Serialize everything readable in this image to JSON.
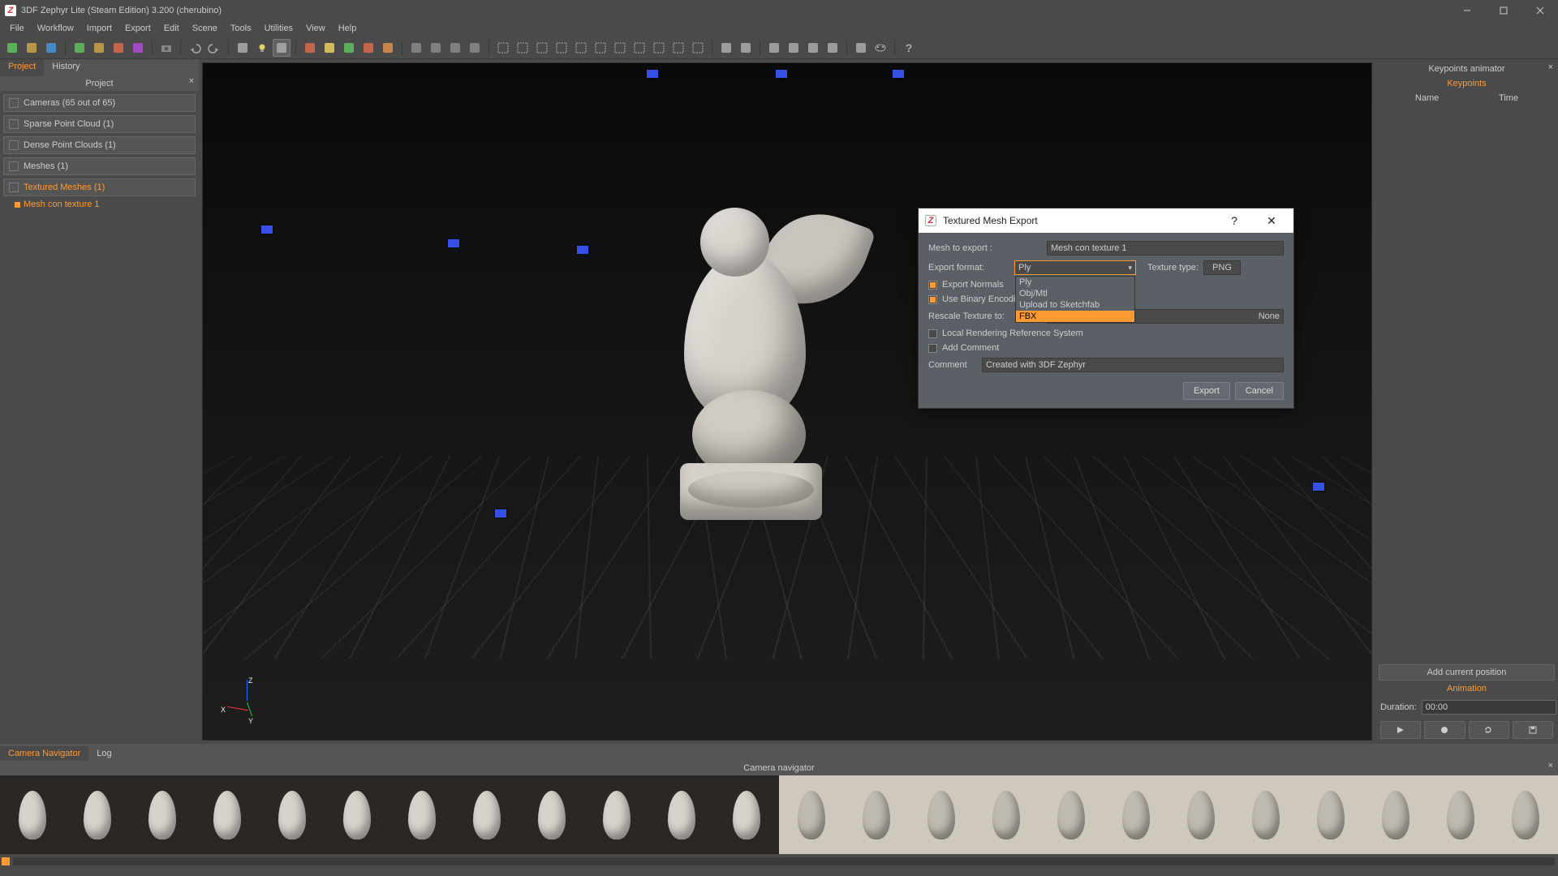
{
  "app": {
    "title": "3DF Zephyr Lite (Steam Edition) 3.200 (cherubino)"
  },
  "menu": [
    "File",
    "Workflow",
    "Import",
    "Export",
    "Edit",
    "Scene",
    "Tools",
    "Utilities",
    "View",
    "Help"
  ],
  "left": {
    "tabs": {
      "project": "Project",
      "history": "History"
    },
    "header": "Project",
    "items": [
      {
        "label": "Cameras (65 out of 65)"
      },
      {
        "label": "Sparse Point Cloud (1)"
      },
      {
        "label": "Dense Point Clouds (1)"
      },
      {
        "label": "Meshes (1)"
      },
      {
        "label": "Textured Meshes (1)",
        "selected": true
      }
    ],
    "subitem": "Mesh con texture 1"
  },
  "gizmo": {
    "x": "X",
    "y": "Y",
    "z": "Z"
  },
  "right": {
    "title": "Keypoints animator",
    "section1": "Keypoints",
    "col_name": "Name",
    "col_time": "Time",
    "add_btn": "Add current position",
    "section2": "Animation",
    "duration_label": "Duration:",
    "duration_value": "00:00"
  },
  "dialog": {
    "title": "Textured Mesh Export",
    "mesh_label": "Mesh to export :",
    "mesh_value": "Mesh con texture 1",
    "format_label": "Export format:",
    "format_value": "Ply",
    "texture_label": "Texture type:",
    "texture_value": "PNG",
    "list": {
      "ply": "Ply",
      "obj": "Obj/Mtl",
      "sketchfab": "Upload to Sketchfab",
      "fbx": "FBX"
    },
    "normals": "Export Normals",
    "binary": "Use Binary Encoding",
    "rescale_label": "Rescale Texture to:",
    "rescale_value": "None",
    "local_ref": "Local Rendering Reference System",
    "add_comment": "Add Comment",
    "comment_label": "Comment",
    "comment_value": "Created with 3DF Zephyr",
    "export_btn": "Export",
    "cancel_btn": "Cancel",
    "help": "?",
    "close": "✕"
  },
  "bottom": {
    "tabs": {
      "camnav": "Camera Navigator",
      "log": "Log"
    },
    "header": "Camera navigator"
  },
  "toolbar_icons": [
    "new",
    "open",
    "save",
    "sep",
    "wiz1",
    "wiz2",
    "wiz3",
    "wiz4",
    "sep",
    "camera",
    "sep",
    "undo",
    "redo",
    "sep",
    "hand",
    "light",
    "bbox",
    "sep",
    "shade1",
    "shade2",
    "shade3",
    "shade4",
    "shade5",
    "sep",
    "pts1",
    "pts2",
    "pts3",
    "pts4",
    "sep",
    "sel-rect",
    "sel-lasso",
    "sel-poly",
    "sel-color",
    "sel-plane",
    "sel-cuboid",
    "sel-inv",
    "sel-all",
    "sel-none",
    "sel-grow",
    "sel-shrink",
    "sep",
    "hide",
    "del",
    "sep",
    "measure",
    "axis",
    "plane",
    "pick",
    "sep",
    "wrench",
    "mask",
    "sep",
    "help"
  ],
  "colors": {
    "accent": "#ff9933"
  }
}
